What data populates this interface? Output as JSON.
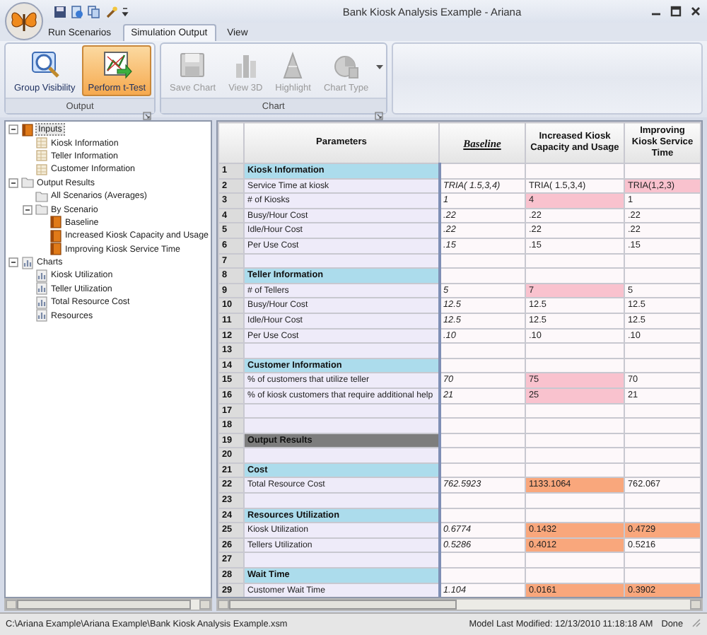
{
  "window": {
    "title": "Bank Kiosk Analysis Example - Ariana"
  },
  "ribbon_tabs": [
    {
      "label": "Run Scenarios",
      "selected": false
    },
    {
      "label": "Simulation Output",
      "selected": true
    },
    {
      "label": "View",
      "selected": false
    }
  ],
  "ribbon_groups": [
    {
      "label": "Output",
      "buttons": [
        {
          "label": "Group Visibility",
          "pressed": false,
          "disabled": false
        },
        {
          "label": "Perform t-Test",
          "pressed": true,
          "disabled": false
        }
      ]
    },
    {
      "label": "Chart",
      "buttons": [
        {
          "label": "Save Chart",
          "pressed": false,
          "disabled": true
        },
        {
          "label": "View 3D",
          "pressed": false,
          "disabled": true
        },
        {
          "label": "Highlight",
          "pressed": false,
          "disabled": true
        },
        {
          "label": "Chart Type",
          "pressed": false,
          "disabled": true,
          "dropdown": true
        }
      ]
    }
  ],
  "tree": [
    {
      "label": "Inputs",
      "kind": "book",
      "selected": true,
      "expanded": true,
      "children": [
        {
          "label": "Kiosk Information",
          "kind": "sheet",
          "selected": false
        },
        {
          "label": "Teller Information",
          "kind": "sheet",
          "selected": false
        },
        {
          "label": "Customer Information",
          "kind": "sheet",
          "selected": false
        }
      ]
    },
    {
      "label": "Output Results",
      "kind": "folder",
      "selected": false,
      "expanded": true,
      "children": [
        {
          "label": "All Scenarios (Averages)",
          "kind": "folder",
          "selected": false
        },
        {
          "label": "By Scenario",
          "kind": "folder",
          "selected": false,
          "expanded": true,
          "children": [
            {
              "label": "Baseline",
              "kind": "book",
              "selected": false
            },
            {
              "label": "Increased Kiosk Capacity and Usage",
              "kind": "book",
              "selected": false
            },
            {
              "label": "Improving Kiosk Service Time",
              "kind": "book",
              "selected": false
            }
          ]
        }
      ]
    },
    {
      "label": "Charts",
      "kind": "chart",
      "selected": false,
      "expanded": true,
      "children": [
        {
          "label": "Kiosk Utilization",
          "kind": "chart",
          "selected": false
        },
        {
          "label": "Teller Utilization",
          "kind": "chart",
          "selected": false
        },
        {
          "label": "Total Resource Cost",
          "kind": "chart",
          "selected": false
        },
        {
          "label": "Resources",
          "kind": "chart",
          "selected": false
        }
      ]
    }
  ],
  "table": {
    "columns": [
      {
        "label": "Parameters",
        "baseline": false
      },
      {
        "label": "Baseline",
        "baseline": true
      },
      {
        "label": "Increased Kiosk Capacity and Usage",
        "baseline": false
      },
      {
        "label": "Improving Kiosk Service Time",
        "baseline": false
      }
    ],
    "rows": [
      {
        "number": "1",
        "kind": "section",
        "label": "Kiosk Information"
      },
      {
        "number": "2",
        "kind": "param",
        "label": "Service Time at kiosk",
        "values": [
          {
            "text": "TRIA( 1.5,3,4)"
          },
          {
            "text": "TRIA( 1.5,3,4)"
          },
          {
            "text": "TRIA(1,2,3)",
            "color": "#f9c2ce"
          }
        ]
      },
      {
        "number": "3",
        "kind": "param",
        "label": "# of Kiosks",
        "values": [
          {
            "text": "1"
          },
          {
            "text": "4",
            "color": "#f9c2ce"
          },
          {
            "text": "1"
          }
        ]
      },
      {
        "number": "4",
        "kind": "param",
        "label": "Busy/Hour Cost",
        "values": [
          {
            "text": ".22"
          },
          {
            "text": ".22"
          },
          {
            "text": ".22"
          }
        ]
      },
      {
        "number": "5",
        "kind": "param",
        "label": "Idle/Hour Cost",
        "values": [
          {
            "text": ".22"
          },
          {
            "text": ".22"
          },
          {
            "text": ".22"
          }
        ]
      },
      {
        "number": "6",
        "kind": "param",
        "label": "Per Use Cost",
        "values": [
          {
            "text": ".15"
          },
          {
            "text": ".15"
          },
          {
            "text": ".15"
          }
        ]
      },
      {
        "number": "7",
        "kind": "blank"
      },
      {
        "number": "8",
        "kind": "section",
        "label": "Teller Information"
      },
      {
        "number": "9",
        "kind": "param",
        "label": "# of Tellers",
        "values": [
          {
            "text": "5"
          },
          {
            "text": "7",
            "color": "#f9c2ce"
          },
          {
            "text": "5"
          }
        ]
      },
      {
        "number": "10",
        "kind": "param",
        "label": "Busy/Hour Cost",
        "values": [
          {
            "text": "12.5"
          },
          {
            "text": "12.5"
          },
          {
            "text": "12.5"
          }
        ]
      },
      {
        "number": "11",
        "kind": "param",
        "label": "Idle/Hour Cost",
        "values": [
          {
            "text": "12.5"
          },
          {
            "text": "12.5"
          },
          {
            "text": "12.5"
          }
        ]
      },
      {
        "number": "12",
        "kind": "param",
        "label": "Per Use Cost",
        "values": [
          {
            "text": ".10"
          },
          {
            "text": ".10"
          },
          {
            "text": ".10"
          }
        ]
      },
      {
        "number": "13",
        "kind": "blank"
      },
      {
        "number": "14",
        "kind": "section",
        "label": "Customer Information"
      },
      {
        "number": "15",
        "kind": "param",
        "label": "% of customers that utilize teller",
        "values": [
          {
            "text": "70"
          },
          {
            "text": "75",
            "color": "#f9c2ce"
          },
          {
            "text": "70"
          }
        ]
      },
      {
        "number": "16",
        "kind": "param",
        "label": "% of  kiosk customers that require additional help",
        "values": [
          {
            "text": "21"
          },
          {
            "text": "25",
            "color": "#f9c2ce"
          },
          {
            "text": "21"
          }
        ]
      },
      {
        "number": "17",
        "kind": "blank"
      },
      {
        "number": "18",
        "kind": "blank"
      },
      {
        "number": "19",
        "kind": "results_header",
        "label": "Output Results"
      },
      {
        "number": "20",
        "kind": "blank"
      },
      {
        "number": "21",
        "kind": "section",
        "label": "Cost"
      },
      {
        "number": "22",
        "kind": "param",
        "label": "Total Resource Cost",
        "values": [
          {
            "text": "762.5923"
          },
          {
            "text": "1133.1064",
            "color": "#f9a77c"
          },
          {
            "text": "762.067"
          }
        ]
      },
      {
        "number": "23",
        "kind": "blank"
      },
      {
        "number": "24",
        "kind": "section",
        "label": "Resources Utilization"
      },
      {
        "number": "25",
        "kind": "param",
        "label": "Kiosk Utilization",
        "values": [
          {
            "text": "0.6774"
          },
          {
            "text": "0.1432",
            "color": "#f9a77c"
          },
          {
            "text": "0.4729",
            "color": "#f9a77c"
          }
        ]
      },
      {
        "number": "26",
        "kind": "param",
        "label": "Tellers Utilization",
        "values": [
          {
            "text": "0.5286"
          },
          {
            "text": "0.4012",
            "color": "#f9a77c"
          },
          {
            "text": "0.5216"
          }
        ]
      },
      {
        "number": "27",
        "kind": "blank"
      },
      {
        "number": "28",
        "kind": "section",
        "label": "Wait Time"
      },
      {
        "number": "29",
        "kind": "param",
        "label": "Customer Wait Time",
        "values": [
          {
            "text": "1.104"
          },
          {
            "text": "0.0161",
            "color": "#f9a77c"
          },
          {
            "text": "0.3902",
            "color": "#f9a77c"
          }
        ]
      }
    ]
  },
  "status_bar": {
    "path": "C:\\Ariana Example\\Ariana Example\\Bank Kiosk Analysis Example.xsm",
    "modified": "Model Last Modified: 12/13/2010 11:18:18 AM",
    "state": "Done"
  }
}
